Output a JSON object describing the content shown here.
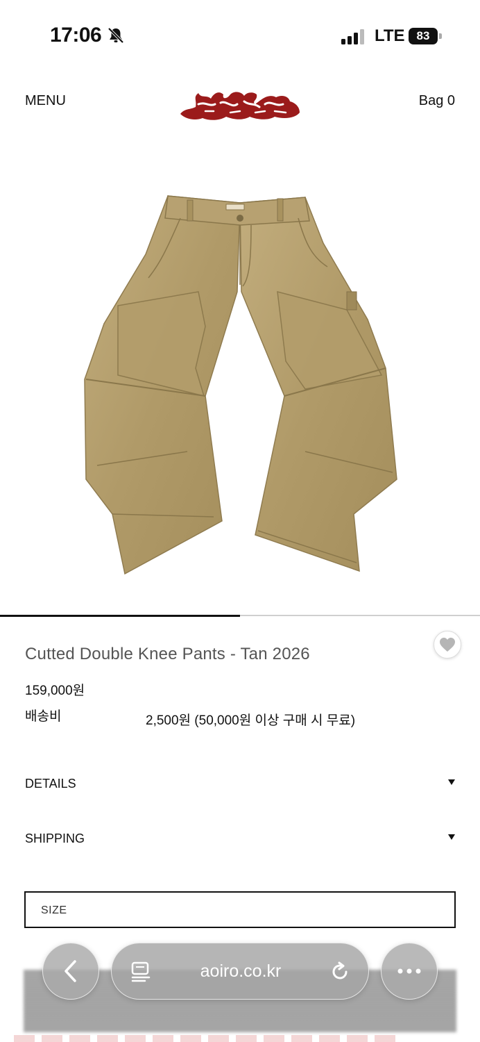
{
  "status_bar": {
    "time": "17:06",
    "network": "LTE",
    "battery": "83"
  },
  "header": {
    "menu_label": "MENU",
    "bag_label": "Bag 0",
    "logo_color": "#9b1b1b"
  },
  "carousel": {
    "progress": 0.5
  },
  "product": {
    "title": "Cutted Double Knee Pants - Tan 2026",
    "price": "159,000원",
    "shipping_label": "배송비",
    "shipping_value": "2,500원 (50,000원 이상 구매 시 무료)",
    "image_color": "#b59f6f"
  },
  "sections": {
    "details_label": "DETAILS",
    "shipping_label": "SHIPPING"
  },
  "size_select": {
    "label": "SIZE"
  },
  "browser": {
    "address": "aoiro.co.kr"
  }
}
